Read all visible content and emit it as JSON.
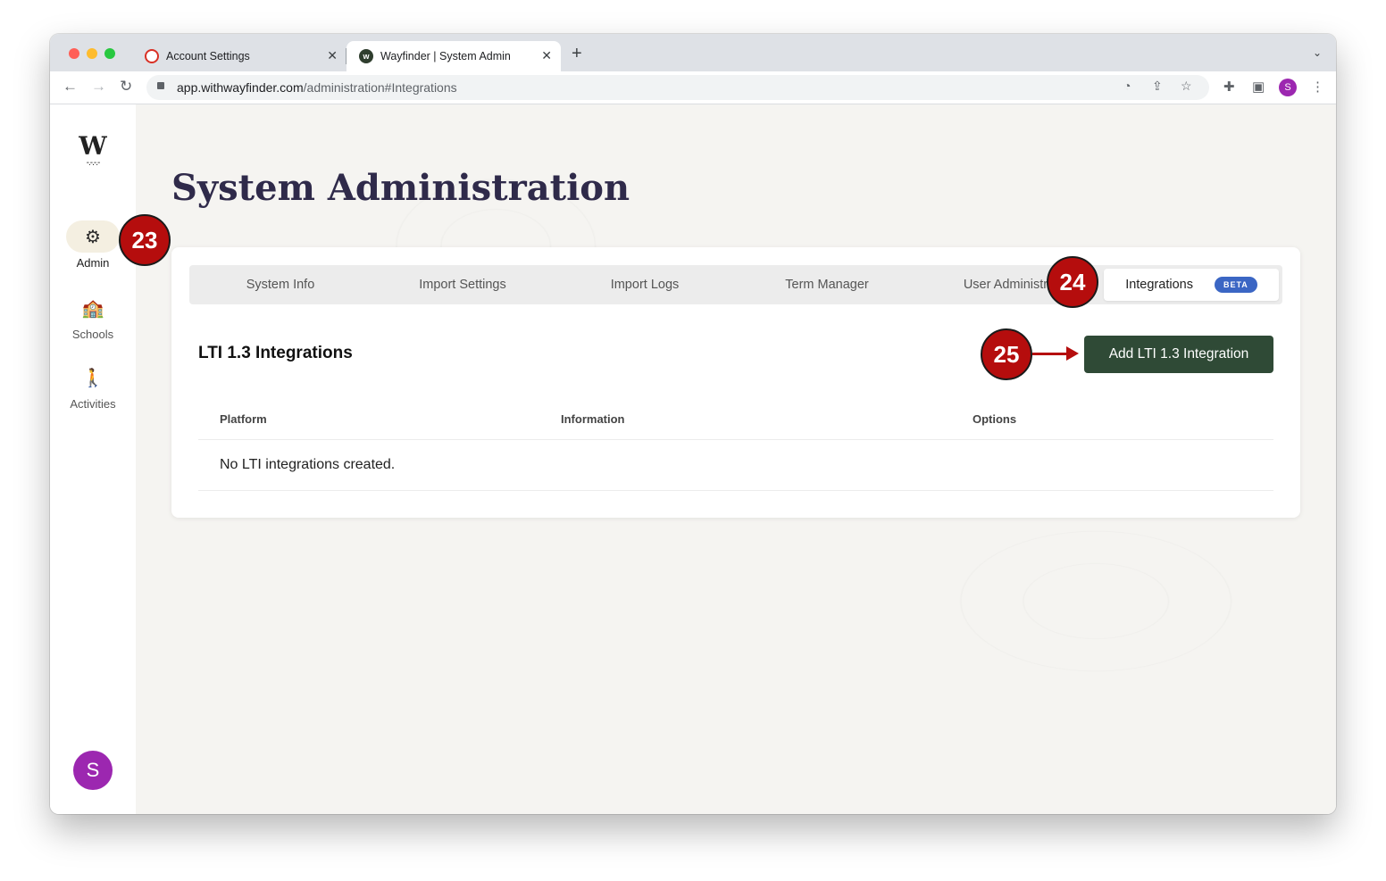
{
  "browser": {
    "tabs": [
      {
        "title": "Account Settings"
      },
      {
        "title": "Wayfinder | System Admin"
      }
    ],
    "url_host": "app.withwayfinder.com",
    "url_path": "/administration#Integrations",
    "profile_initial": "S"
  },
  "sidebar": {
    "logo": "W",
    "logo_wave": "-.-.-.-",
    "items": [
      {
        "label": "Admin",
        "icon": "gear-icon"
      },
      {
        "label": "Schools",
        "icon": "school-icon"
      },
      {
        "label": "Activities",
        "icon": "hiker-icon"
      }
    ],
    "user_initial": "S"
  },
  "page": {
    "title": "System Administration",
    "tabs": [
      {
        "label": "System Info"
      },
      {
        "label": "Import Settings"
      },
      {
        "label": "Import Logs"
      },
      {
        "label": "Term Manager"
      },
      {
        "label": "User Administra"
      },
      {
        "label": "Integrations",
        "badge": "BETA"
      }
    ],
    "section_title": "LTI 1.3 Integrations",
    "add_button": "Add LTI 1.3 Integration",
    "table": {
      "headers": [
        "Platform",
        "Information",
        "Options"
      ],
      "empty_message": "No LTI integrations created."
    }
  },
  "annotations": [
    "23",
    "24",
    "25"
  ],
  "colors": {
    "marker": "#b50d0d",
    "button": "#2f4a36",
    "title": "#2f2a4a",
    "beta_badge": "#3b66c4",
    "avatar": "#9c27b0"
  }
}
